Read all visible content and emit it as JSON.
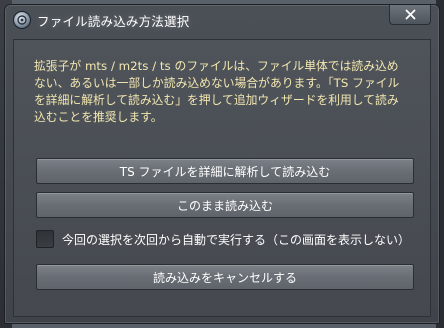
{
  "window": {
    "title": "ファイル読み込み方法選択",
    "app_icon": "app-logo-icon",
    "close_icon": "close-icon"
  },
  "message": {
    "line1": "拡張子が mts / m2ts / ts のファイルは、ファイル単体では読み込め",
    "line2": "ない、あるいは一部しか読み込めない場合があります。「TS ファイル",
    "line3": "を詳細に解析して読み込む」を押して追加ウィザードを利用して読み",
    "line4": "込むことを推奨します。"
  },
  "buttons": {
    "analyze_label": "TS ファイルを詳細に解析して読み込む",
    "as_is_label": "このまま読み込む",
    "cancel_label": "読み込みをキャンセルする"
  },
  "checkbox": {
    "label": "今回の選択を次回から自動で実行する（この画面を表示しない）",
    "checked": false
  },
  "colors": {
    "message_text": "#f3e7b0",
    "button_face": "#6e737a",
    "window_bg": "#4a4f55"
  }
}
